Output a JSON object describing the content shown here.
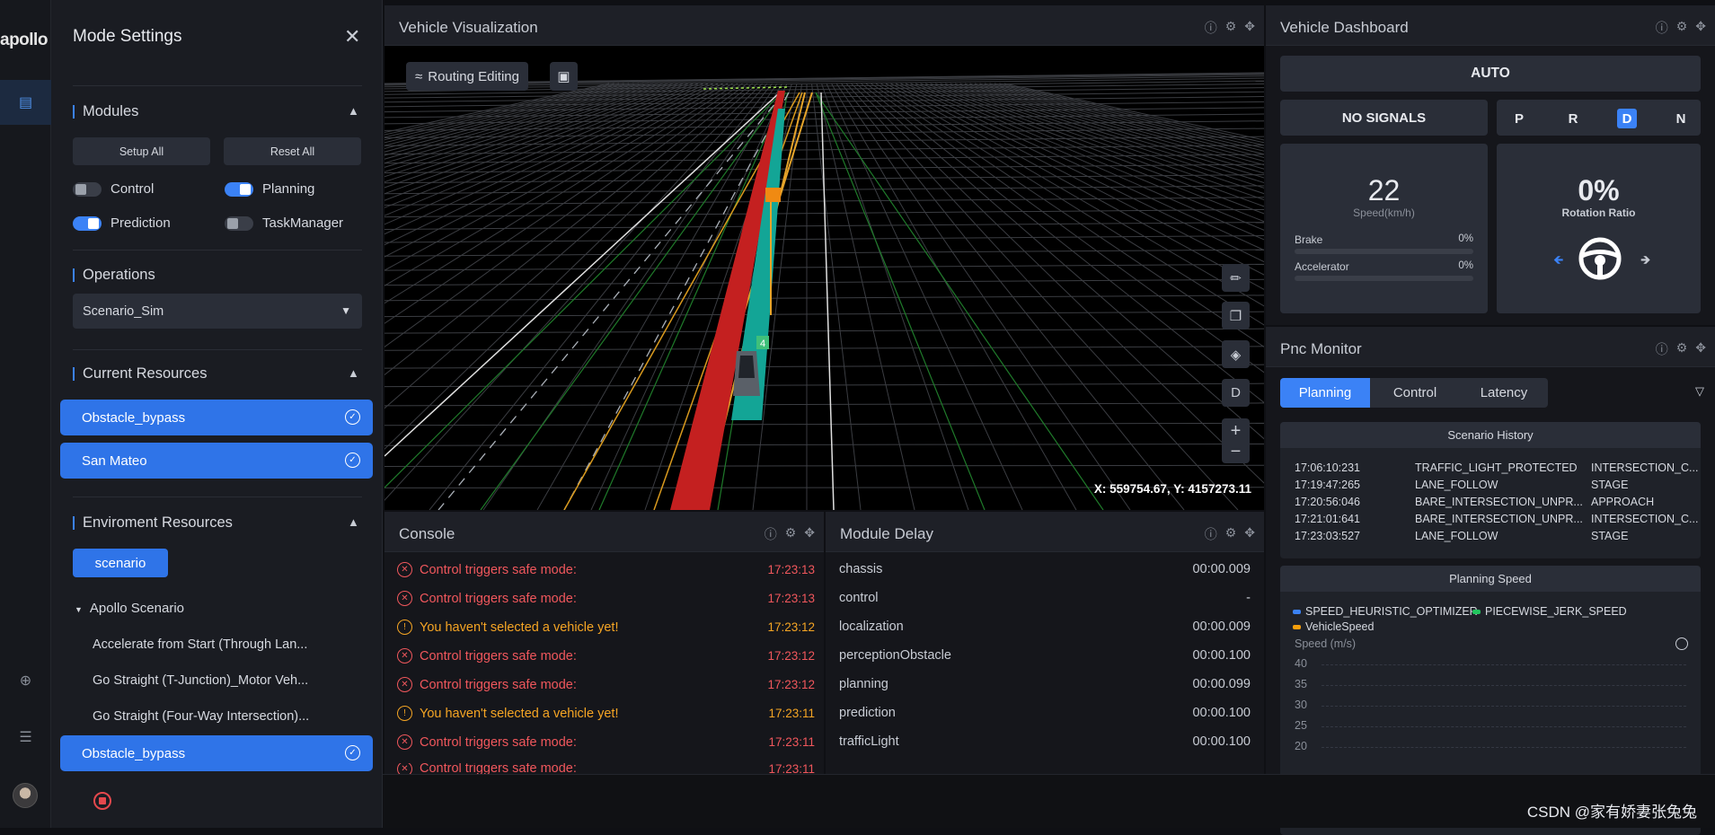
{
  "app": {
    "logo": "apollo"
  },
  "rail": {
    "items": [
      "document-icon",
      "plus-circle-icon",
      "list-icon"
    ]
  },
  "mode_settings": {
    "title": "Mode Settings",
    "modules": {
      "title": "Modules",
      "setup_all": "Setup All",
      "reset_all": "Reset All",
      "toggles": [
        {
          "label": "Control",
          "on": false
        },
        {
          "label": "Planning",
          "on": true
        },
        {
          "label": "Prediction",
          "on": true
        },
        {
          "label": "TaskManager",
          "on": false
        }
      ]
    },
    "operations": {
      "title": "Operations",
      "selected": "Scenario_Sim"
    },
    "current_resources": {
      "title": "Current Resources",
      "items": [
        "Obstacle_bypass",
        "San Mateo"
      ]
    },
    "environment_resources": {
      "title": "Enviroment Resources",
      "tag": "scenario",
      "group": "Apollo Scenario",
      "items": [
        "Accelerate from Start (Through Lan...",
        "Go Straight (T-Junction)_Motor Veh...",
        "Go Straight (Four-Way Intersection)...",
        "Obstacle_bypass"
      ],
      "selected_item": "Obstacle_bypass"
    }
  },
  "visualization": {
    "title": "Vehicle Visualization",
    "routing_editing": "Routing Editing",
    "coordinates": "X: 559754.67, Y: 4157273.11",
    "tools": {
      "view_label": "D",
      "zoom_in": "+",
      "zoom_out": "−"
    },
    "marker_label": "4"
  },
  "console": {
    "title": "Console",
    "logs": [
      {
        "level": "error",
        "text": "Control triggers safe mode:",
        "time": "17:23:13"
      },
      {
        "level": "error",
        "text": "Control triggers safe mode:",
        "time": "17:23:13"
      },
      {
        "level": "warn",
        "text": "You haven't selected a vehicle yet!",
        "time": "17:23:12"
      },
      {
        "level": "error",
        "text": "Control triggers safe mode:",
        "time": "17:23:12"
      },
      {
        "level": "error",
        "text": "Control triggers safe mode:",
        "time": "17:23:12"
      },
      {
        "level": "warn",
        "text": "You haven't selected a vehicle yet!",
        "time": "17:23:11"
      },
      {
        "level": "error",
        "text": "Control triggers safe mode:",
        "time": "17:23:11"
      },
      {
        "level": "error",
        "text": "Control triggers safe mode:",
        "time": "17:23:11"
      }
    ]
  },
  "module_delay": {
    "title": "Module Delay",
    "rows": [
      {
        "name": "chassis",
        "value": "00:00.009"
      },
      {
        "name": "control",
        "value": "-"
      },
      {
        "name": "localization",
        "value": "00:00.009"
      },
      {
        "name": "perceptionObstacle",
        "value": "00:00.100"
      },
      {
        "name": "planning",
        "value": "00:00.099"
      },
      {
        "name": "prediction",
        "value": "00:00.100"
      },
      {
        "name": "trafficLight",
        "value": "00:00.100"
      }
    ]
  },
  "dashboard": {
    "title": "Vehicle Dashboard",
    "mode": "AUTO",
    "signals": "NO SIGNALS",
    "gears": [
      "P",
      "R",
      "D",
      "N"
    ],
    "active_gear": "D",
    "speed": "22",
    "speed_unit": "Speed(km/h)",
    "brake_label": "Brake",
    "brake_value": "0%",
    "brake_fraction": 0,
    "accel_label": "Accelerator",
    "accel_value": "0%",
    "accel_fraction": 0,
    "rotation": "0%",
    "rotation_label": "Rotation Ratio",
    "colors": {
      "accent": "#3b82f6"
    }
  },
  "pnc": {
    "title": "Pnc Monitor",
    "tabs": [
      "Planning",
      "Control",
      "Latency"
    ],
    "active_tab": "Planning",
    "scenario_history": {
      "title": "Scenario History",
      "rows": [
        [
          "17:06:10:231",
          "TRAFFIC_LIGHT_PROTECTED",
          "INTERSECTION_C..."
        ],
        [
          "17:19:47:265",
          "LANE_FOLLOW",
          "STAGE"
        ],
        [
          "17:20:56:046",
          "BARE_INTERSECTION_UNPR...",
          "APPROACH"
        ],
        [
          "17:21:01:641",
          "BARE_INTERSECTION_UNPR...",
          "INTERSECTION_C..."
        ],
        [
          "17:23:03:527",
          "LANE_FOLLOW",
          "STAGE"
        ]
      ]
    },
    "planning_speed": {
      "title": "Planning Speed",
      "legend": [
        {
          "name": "SPEED_HEURISTIC_OPTIMIZER",
          "color": "#3b82f6"
        },
        {
          "name": "PIECEWISE_JERK_SPEED",
          "color": "#22c55e"
        },
        {
          "name": "VehicleSpeed",
          "color": "#f59e0b"
        }
      ],
      "ylabel": "Speed (m/s)",
      "yticks": [
        "40",
        "35",
        "30",
        "25",
        "20"
      ]
    }
  },
  "watermark": "CSDN @家有娇妻张兔兔"
}
